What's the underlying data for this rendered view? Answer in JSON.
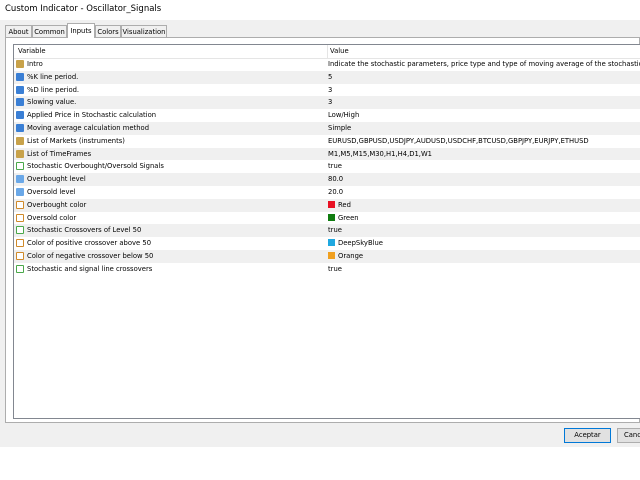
{
  "window": {
    "title": "Custom Indicator - Oscillator_Signals"
  },
  "tabs": [
    "About",
    "Common",
    "Inputs",
    "Colors",
    "Visualization"
  ],
  "active_tab": "Inputs",
  "grid": {
    "headers": {
      "variable": "Variable",
      "value": "Value"
    },
    "rows": [
      {
        "icon": "ab-string-icon",
        "type": "ab",
        "name": "Intro",
        "value": "Indicate the stochastic parameters, price type and type of moving average of the stochastic"
      },
      {
        "icon": "integer-icon",
        "type": "num",
        "name": "%K line period.",
        "value": "5"
      },
      {
        "icon": "integer-icon",
        "type": "num",
        "name": "%D line period.",
        "value": "3"
      },
      {
        "icon": "integer-icon",
        "type": "num",
        "name": "Slowing value.",
        "value": "3"
      },
      {
        "icon": "enum-icon",
        "type": "enm",
        "name": "Applied Price in Stochastic calculation",
        "value": "Low/High"
      },
      {
        "icon": "enum-icon",
        "type": "enm",
        "name": "Moving average calculation method",
        "value": "Simple"
      },
      {
        "icon": "ab-string-icon",
        "type": "ab",
        "name": "List of Markets (instruments)",
        "value": "EURUSD,GBPUSD,USDJPY,AUDUSD,USDCHF,BTCUSD,GBPJPY,EURJPY,ETHUSD"
      },
      {
        "icon": "ab-string-icon",
        "type": "ab",
        "name": "List of TimeFrames",
        "value": "M1,M5,M15,M30,H1,H4,D1,W1"
      },
      {
        "icon": "bool-icon",
        "type": "bool",
        "name": "Stochastic Overbought/Oversold Signals",
        "value": "true"
      },
      {
        "icon": "double-icon",
        "type": "dbl",
        "name": "Overbought level",
        "value": "80.0"
      },
      {
        "icon": "double-icon",
        "type": "dbl",
        "name": "Oversold level",
        "value": "20.0"
      },
      {
        "icon": "color-icon",
        "type": "clr",
        "name": "Overbought color",
        "value": "Red",
        "swatch": "#e81123"
      },
      {
        "icon": "color-icon",
        "type": "clr",
        "name": "Oversold color",
        "value": "Green",
        "swatch": "#107c10"
      },
      {
        "icon": "bool-icon",
        "type": "bool",
        "name": "Stochastic Crossovers of Level 50",
        "value": "true"
      },
      {
        "icon": "color-icon",
        "type": "clr",
        "name": "Color of positive crossover above 50",
        "value": "DeepSkyBlue",
        "swatch": "#1fa8e0"
      },
      {
        "icon": "color-icon",
        "type": "clr",
        "name": "Color of negative crossover below 50",
        "value": "Orange",
        "swatch": "#f0a020"
      },
      {
        "icon": "bool-icon",
        "type": "bool",
        "name": "Stochastic and signal line crossovers",
        "value": "true"
      }
    ]
  },
  "buttons": {
    "ok": "Aceptar",
    "cancel": "Canc"
  }
}
